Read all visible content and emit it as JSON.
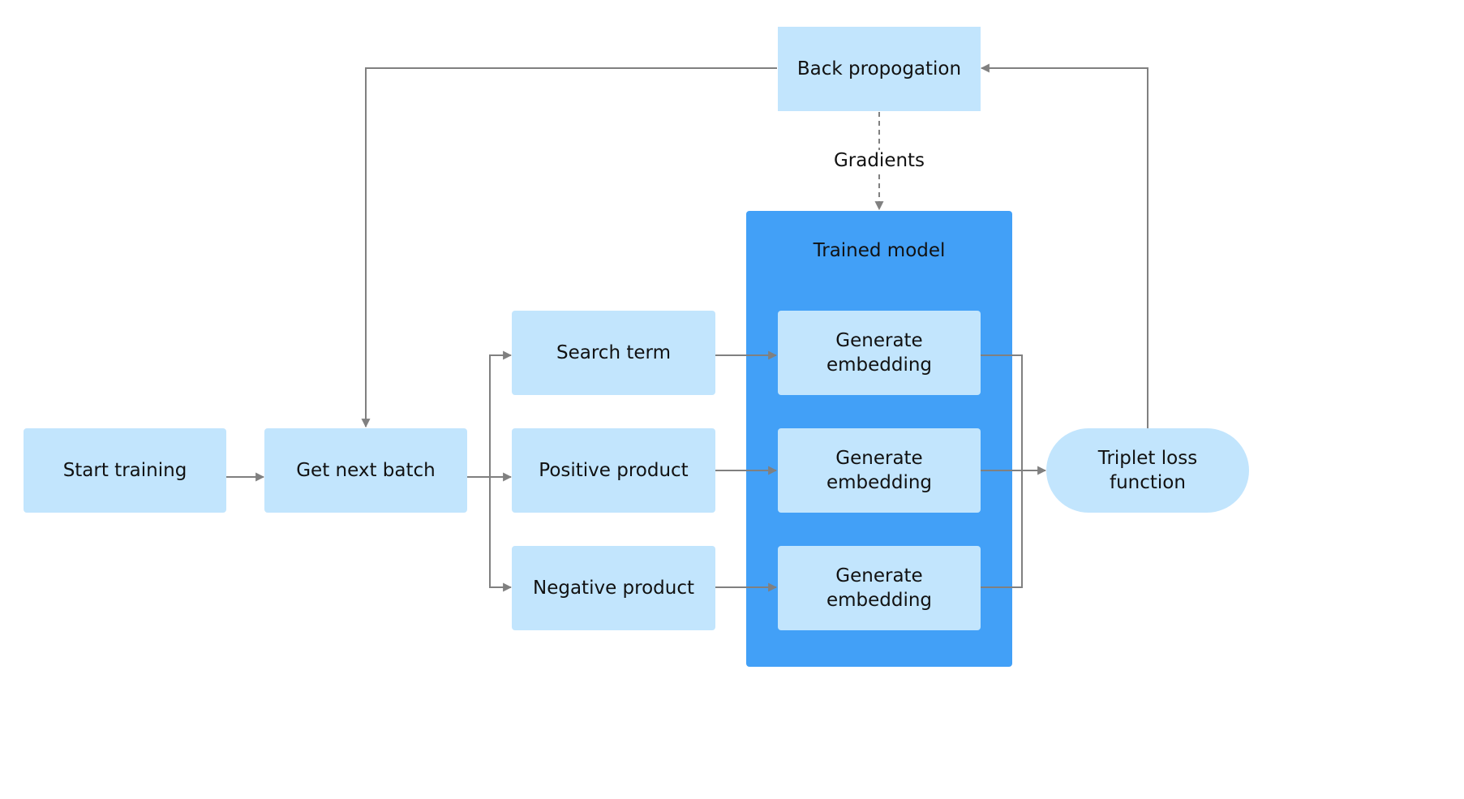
{
  "diagram": {
    "colors": {
      "node_fill": "#c2e5fd",
      "container_fill": "#42a0f7",
      "edge": "#808080",
      "text": "#111111"
    },
    "nodes": {
      "start_training": "Start training",
      "get_next_batch": "Get next batch",
      "search_term": "Search term",
      "positive_product": "Positive product",
      "negative_product": "Negative product",
      "generate_embedding_1": "Generate\nembedding",
      "generate_embedding_2": "Generate\nembedding",
      "generate_embedding_3": "Generate\nembedding",
      "triplet_loss": "Triplet loss\nfunction",
      "back_propagation": "Back propogation"
    },
    "container": {
      "title": "Trained model"
    },
    "edges": [
      {
        "from": "start_training",
        "to": "get_next_batch",
        "style": "solid"
      },
      {
        "from": "get_next_batch",
        "to": "search_term",
        "style": "solid"
      },
      {
        "from": "get_next_batch",
        "to": "positive_product",
        "style": "solid"
      },
      {
        "from": "get_next_batch",
        "to": "negative_product",
        "style": "solid"
      },
      {
        "from": "search_term",
        "to": "generate_embedding_1",
        "style": "solid"
      },
      {
        "from": "positive_product",
        "to": "generate_embedding_2",
        "style": "solid"
      },
      {
        "from": "negative_product",
        "to": "generate_embedding_3",
        "style": "solid"
      },
      {
        "from": "generate_embedding_1",
        "to": "triplet_loss",
        "style": "solid"
      },
      {
        "from": "generate_embedding_2",
        "to": "triplet_loss",
        "style": "solid"
      },
      {
        "from": "generate_embedding_3",
        "to": "triplet_loss",
        "style": "solid"
      },
      {
        "from": "triplet_loss",
        "to": "back_propagation",
        "style": "solid"
      },
      {
        "from": "back_propagation",
        "to": "get_next_batch",
        "style": "solid"
      },
      {
        "from": "back_propagation",
        "to": "trained_model",
        "style": "dashed",
        "label": "Gradients"
      }
    ],
    "edge_labels": {
      "gradients": "Gradients"
    }
  }
}
